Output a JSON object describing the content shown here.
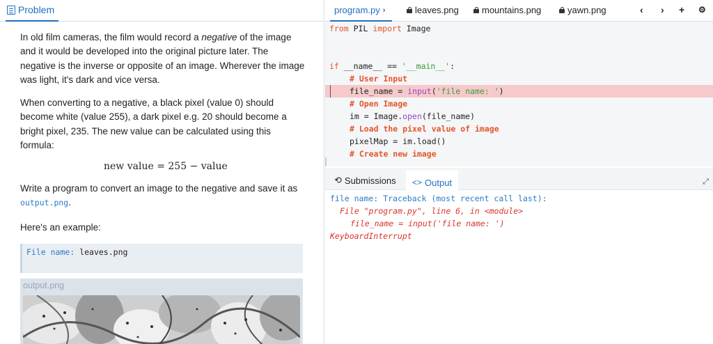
{
  "problem": {
    "tab_label": "Problem",
    "p1": "In old film cameras, the film would record a negative of the image and it would be developed into the original picture later. The negative is the inverse or opposite of an image. Wherever the image was light, it's dark and vice versa.",
    "p1_pre": "In old film cameras, the film would record a ",
    "p1_em": "negative",
    "p1_post": " of the image and it would be developed into the original picture later. The negative is the inverse or opposite of an image. Wherever the image was light, it's dark and vice versa.",
    "p2": "When converting to a negative, a black pixel (value 0) should become white (value 255), a dark pixel e.g. 20 should become a bright pixel, 235. The new value can be calculated using this formula:",
    "formula": "new value = 255 − value",
    "p3_pre": "Write a program to convert an image to the negative and save it as ",
    "p3_code": "output.png",
    "p3_post": ".",
    "p4": "Here's an example:",
    "example_label": "File name:",
    "example_value": "leaves.png",
    "output_label": "output.png"
  },
  "file_tabs": [
    {
      "label": "program.py",
      "active": true
    },
    {
      "label": "leaves.png",
      "locked": true
    },
    {
      "label": "mountains.png",
      "locked": true
    },
    {
      "label": "yawn.png",
      "locked": true
    }
  ],
  "tab_controls": {
    "prev": "‹",
    "next": "›",
    "add": "+",
    "settings": "⚙"
  },
  "code": {
    "line1": {
      "kw": "from",
      "a": " PIL ",
      "kw2": "import",
      "b": " Image"
    },
    "line4": {
      "kw": "if",
      "a": " __name__ == ",
      "str": "'__main__'",
      "b": ":"
    },
    "line5": "# User Input",
    "line6": {
      "a": "file_name = ",
      "fn": "input",
      "b": "(",
      "str": "'file name: '",
      "c": ")"
    },
    "line7": "# Open Image",
    "line8": {
      "a": "im = Image.",
      "fn": "open",
      "b": "(file_name)"
    },
    "line9": "# Load the pixel value of image",
    "line10": "pixelMap = im.load()",
    "line11": "# Create new image"
  },
  "output_tabs": {
    "submissions": "Submissions",
    "output": "Output"
  },
  "console": {
    "l1_label": "file name:",
    "l1_rest": " Traceback (most recent call last):",
    "l2": "File \"program.py\", line 6, in <module>",
    "l3": "file_name = input('file name: ')",
    "l4": "KeyboardInterrupt"
  },
  "colors": {
    "accent": "#1f6fbf",
    "error_highlight": "#f6c9cb",
    "keyword": "#e3562a",
    "string": "#3a9a3a",
    "builtin": "#9a44c4",
    "error_text": "#d9342b"
  }
}
